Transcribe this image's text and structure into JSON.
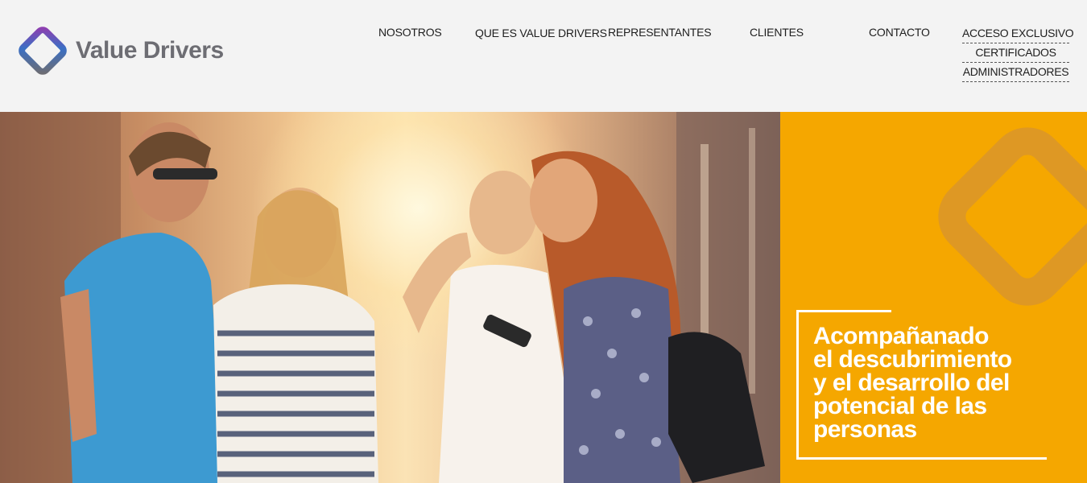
{
  "brand": {
    "name": "Value Drivers",
    "colors": {
      "accent": "#f5a700",
      "logo_text": "#6d6d73",
      "logo_gradient": [
        "#8e3fb0",
        "#3a6fc4",
        "#6d6d73"
      ]
    }
  },
  "nav": {
    "items": [
      {
        "label": "NOSOTROS"
      },
      {
        "label": "QUE ES VALUE DRIVERS"
      },
      {
        "label": "REPRESENTANTES"
      },
      {
        "label": "CLIENTES"
      },
      {
        "label": "CONTACTO"
      }
    ],
    "exclusive": [
      {
        "label": "ACCESO EXCLUSIVO"
      },
      {
        "label": "CERTIFICADOS"
      },
      {
        "label": "ADMINISTRADORES"
      }
    ]
  },
  "hero": {
    "tagline_lines": [
      "Acompañanado",
      "el descubrimiento",
      "y el desarrollo del",
      "potencial de las",
      "personas"
    ],
    "panel_color": "#f5a700"
  }
}
